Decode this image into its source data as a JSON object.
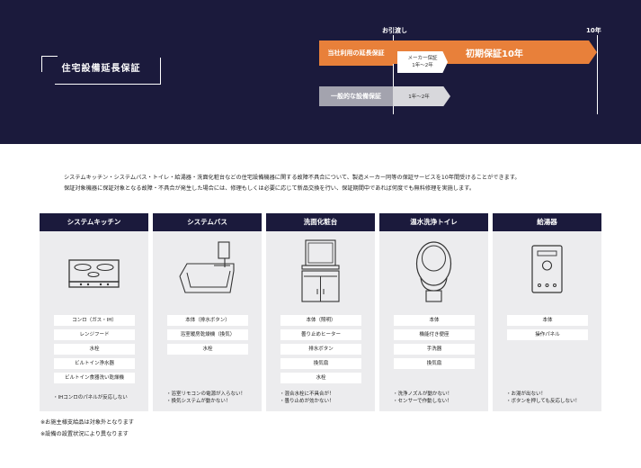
{
  "header": {
    "title": "住宅設備延長保証",
    "handover": "お引渡し",
    "ten_years": "10年",
    "row1_label": "当社利用の延長保証",
    "maker_line1": "メーカー保証",
    "maker_line2": "1年～2年",
    "initial": "初期保証10年",
    "row2_label": "一般的な設備保証",
    "general_years": "1年～2年",
    "colors": {
      "navy": "#1b1a3c",
      "orange": "#e8803a",
      "gray_bar": "#a3a3ae"
    }
  },
  "intro": {
    "line1": "システムキッチン・システムバス・トイレ・給湯器・洗面化粧台などの住宅設備機器に関する故障不具合について、製造メーカー同等の保証サービスを10年間受けることができます。",
    "line2": "保証対象機器に保証対象となる故障・不具合が発生した場合には、修理もしくは必要に応じて新品交換を行い、保証期間中であれば何度でも無料修理を実施します。"
  },
  "columns": [
    {
      "title": "システムキッチン",
      "icon": "stove-icon",
      "items": [
        "コンロ（ガス・IH）",
        "レンジフード",
        "水栓",
        "ビルトイン浄水器",
        "ビルトイン食器洗い乾燥機"
      ],
      "notes": [
        "・IHコンロのパネルが反応しない"
      ]
    },
    {
      "title": "システムバス",
      "icon": "bathtub-icon",
      "items": [
        "本体（排水ボタン）",
        "浴室暖房乾燥機（換気）",
        "水栓"
      ],
      "notes": [
        "・浴室リモコンの電源が入らない！",
        "・换気システムが動かない！"
      ]
    },
    {
      "title": "洗面化粧台",
      "icon": "vanity-icon",
      "items": [
        "本体（照明）",
        "曇り止めヒーター",
        "排水ボタン",
        "換気扇",
        "水栓"
      ],
      "notes": [
        "・混合水栓に不具合が！",
        "・曇り止めが効かない！"
      ]
    },
    {
      "title": "温水洗浄トイレ",
      "icon": "toilet-icon",
      "items": [
        "本体",
        "機能付き便座",
        "手洗器",
        "換気扇"
      ],
      "notes": [
        "・洗浄ノズルが動かない！",
        "・センサーで作動しない！"
      ]
    },
    {
      "title": "給湯器",
      "icon": "water-heater-icon",
      "items": [
        "本体",
        "操作パネル"
      ],
      "notes": [
        "・お湯が出ない！",
        "・ボタンを押しても反応しない！"
      ]
    }
  ],
  "footnotes": [
    "※お施主様支給品は対象外となります",
    "※設備の設置状況により異なります"
  ]
}
